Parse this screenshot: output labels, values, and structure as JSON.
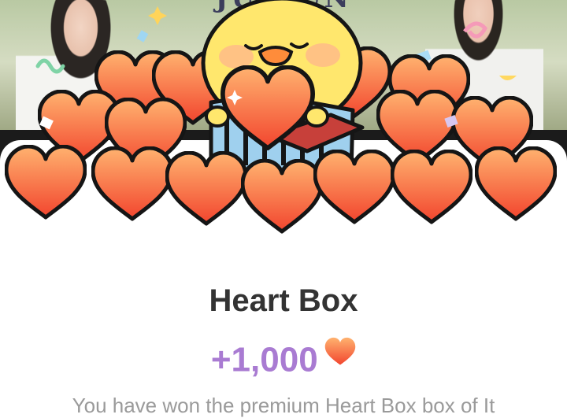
{
  "banner": {
    "text": "JUN  UN"
  },
  "reward": {
    "title": "Heart Box",
    "amount": "+1,000",
    "amount_icon": "heart-icon",
    "description": "You have won the premium Heart Box box of It"
  },
  "colors": {
    "title": "#333333",
    "amount": "#a97bd2",
    "heart_light": "#ffb26f",
    "heart_dark": "#f2452e",
    "chick": "#ffe76d"
  }
}
